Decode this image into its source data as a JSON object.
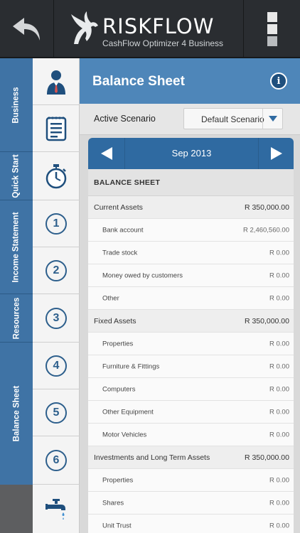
{
  "brand": {
    "name": "RISKFLOW",
    "subtitle": "CashFlow Optimizer 4 Business"
  },
  "side_tabs": [
    {
      "label": "Business"
    },
    {
      "label": "Quick Start"
    },
    {
      "label": "Income Statement"
    },
    {
      "label": "Resources"
    },
    {
      "label": "Balance Sheet"
    }
  ],
  "icon_column": {
    "numbers": [
      "1",
      "2",
      "3",
      "4",
      "5",
      "6"
    ]
  },
  "header": {
    "title": "Balance Sheet",
    "info_label": "i"
  },
  "scenario": {
    "label": "Active Scenario",
    "value": "Default Scenario"
  },
  "month": {
    "label": "Sep 2013"
  },
  "sheet": {
    "title": "BALANCE SHEET",
    "rows": [
      {
        "type": "group",
        "label": "Current Assets",
        "amount": "R 350,000.00"
      },
      {
        "type": "sub",
        "label": "Bank account",
        "amount": "R 2,460,560.00"
      },
      {
        "type": "sub",
        "label": "Trade stock",
        "amount": "R 0.00"
      },
      {
        "type": "sub",
        "label": "Money owed by customers",
        "amount": "R 0.00"
      },
      {
        "type": "sub",
        "label": "Other",
        "amount": "R 0.00"
      },
      {
        "type": "group",
        "label": "Fixed Assets",
        "amount": "R 350,000.00"
      },
      {
        "type": "sub",
        "label": "Properties",
        "amount": "R 0.00"
      },
      {
        "type": "sub",
        "label": "Furniture & Fittings",
        "amount": "R 0.00"
      },
      {
        "type": "sub",
        "label": "Computers",
        "amount": "R 0.00"
      },
      {
        "type": "sub",
        "label": "Other Equipment",
        "amount": "R 0.00"
      },
      {
        "type": "sub",
        "label": "Motor Vehicles",
        "amount": "R 0.00"
      },
      {
        "type": "group",
        "label": "Investments and Long Term Assets",
        "amount": "R 350,000.00"
      },
      {
        "type": "sub",
        "label": "Properties",
        "amount": "R 0.00"
      },
      {
        "type": "sub",
        "label": "Shares",
        "amount": "R 0.00"
      },
      {
        "type": "sub",
        "label": "Unit Trust",
        "amount": "R 0.00"
      }
    ]
  },
  "colors": {
    "topbar": "#2a2d31",
    "tab_blue": "#3f73a5",
    "header_blue": "#4e86b9",
    "month_bar": "#2f6aa1"
  }
}
